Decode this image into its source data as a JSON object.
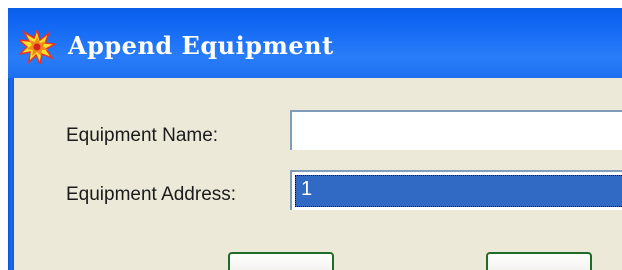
{
  "window": {
    "title": "Append Equipment",
    "icon": "starburst-app-icon"
  },
  "form": {
    "name_label": "Equipment Name:",
    "name_value": "",
    "address_label": "Equipment Address:",
    "address_value": "1"
  },
  "colors": {
    "titlebar": "#2a7df9",
    "dialog_bg": "#ece9d8",
    "selection": "#316ac5",
    "field_border": "#7f9db9",
    "button_border": "#1f6b2a"
  }
}
